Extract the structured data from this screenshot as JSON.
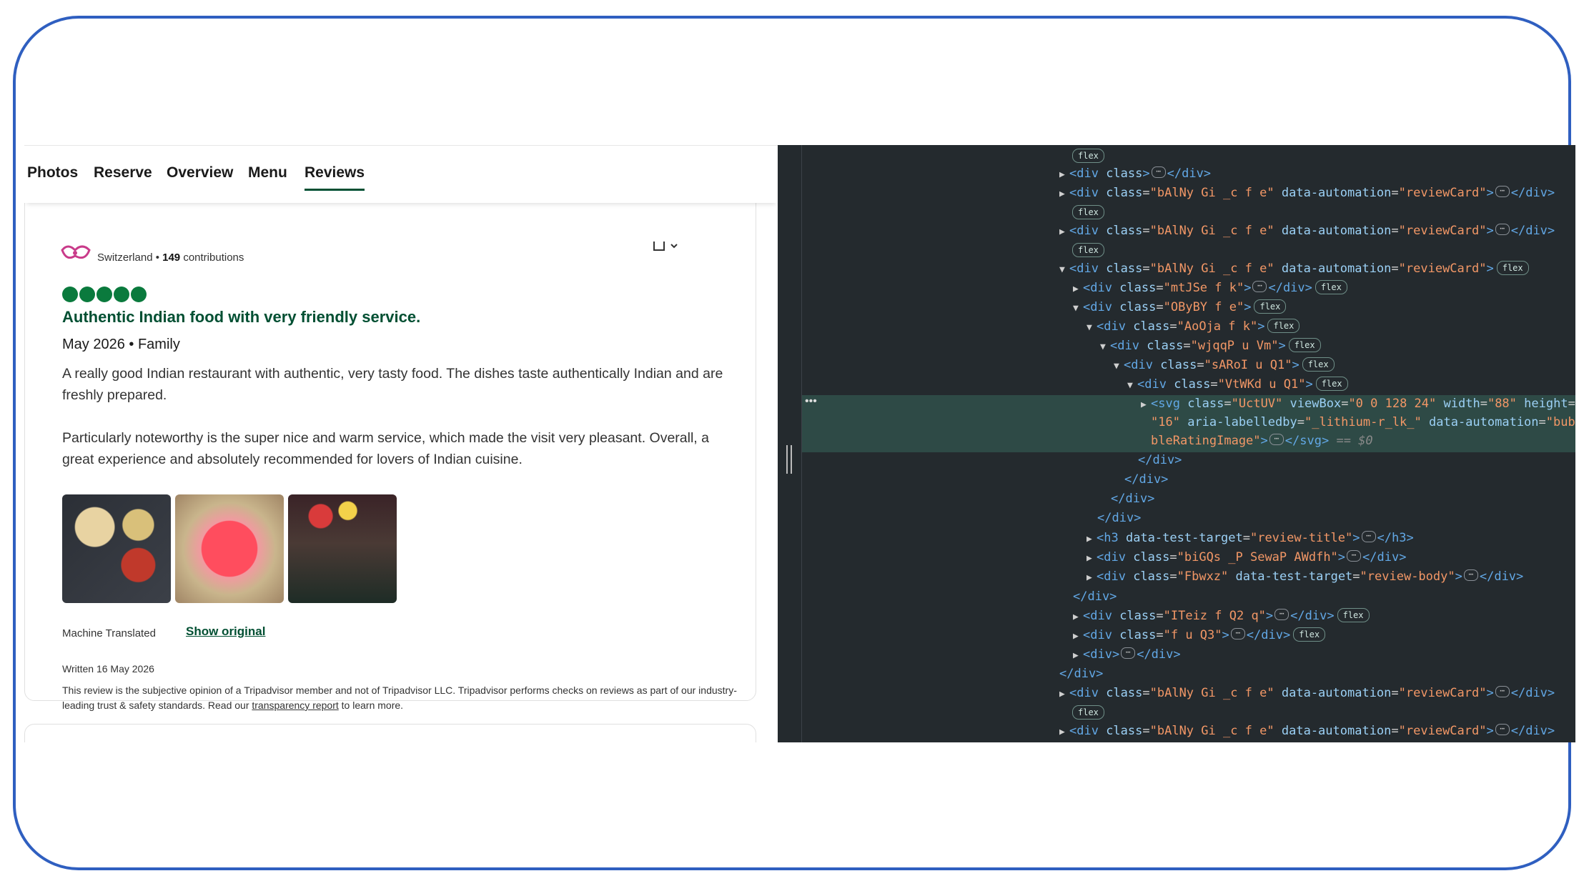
{
  "tabs": [
    "Photos",
    "Reserve",
    "Overview",
    "Menu",
    "Reviews"
  ],
  "active_tab": "Reviews",
  "review": {
    "reviewer_location": "Switzerland • ",
    "contributions": "149",
    "contributions_label": " contributions",
    "rating": 5,
    "title": "Authentic Indian food with very friendly service.",
    "visit": "May 2026 • Family",
    "paragraph1": "A really good Indian restaurant with authentic, very tasty food. The dishes taste authentically Indian and are freshly prepared.",
    "paragraph2": "Particularly noteworthy is the super nice and warm service, which made the visit very pleasant. Overall, a great experience and absolutely recommended for lovers of Indian cuisine.",
    "machine_translated": "Machine Translated",
    "show_original": "Show original",
    "written": "Written 16 May 2026",
    "disclaimer_before": "This review is the subjective opinion of a Tripadvisor member and not of Tripadvisor LLC. Tripadvisor performs checks on reviews as part of our industry-leading trust & safety standards. Read our ",
    "disclaimer_link": "transparency report",
    "disclaimer_after": " to learn more."
  },
  "devtools": {
    "badge": "flex",
    "svg_note": "== $0",
    "lines": [
      {
        "t": "<div class=\"bAlNy Gi _c f e\" data-automation=\"reviewCard\">"
      },
      {
        "t": "<div class=\"mtJSe f k\">"
      },
      {
        "t": "<div class=\"OByBY f e\">"
      },
      {
        "t": "<div class=\"AoOja f k\">"
      },
      {
        "t": "<div class=\"wjqqP u Vm\">"
      },
      {
        "t": "<div class=\"sARoI u Q1\">"
      },
      {
        "t": "<div class=\"VtWKd u Q1\">"
      },
      {
        "t": "<svg class=\"UctUV\" viewBox=\"0 0 128 24\" width=\"88\" height=\"16\" aria-labelledby=\"_lithium-r_lk_\" data-automation=\"bubbleRatingImage\">"
      },
      {
        "t": "<h3 data-test-target=\"review-title\">"
      },
      {
        "t": "<div class=\"biGQs _P SewaP AWdfh\">"
      },
      {
        "t": "<div class=\"Fbwxz\" data-test-target=\"review-body\">"
      },
      {
        "t": "<div class=\"ITeiz f Q2 q\">"
      },
      {
        "t": "<div class=\"f u Q3\">"
      },
      {
        "t": "<div>"
      }
    ]
  },
  "colors": {
    "brand_green": "#004f32",
    "bubble_green": "#0a7a3d",
    "frame_blue": "#2f5fc0",
    "devtools_bg": "#242a2e"
  }
}
